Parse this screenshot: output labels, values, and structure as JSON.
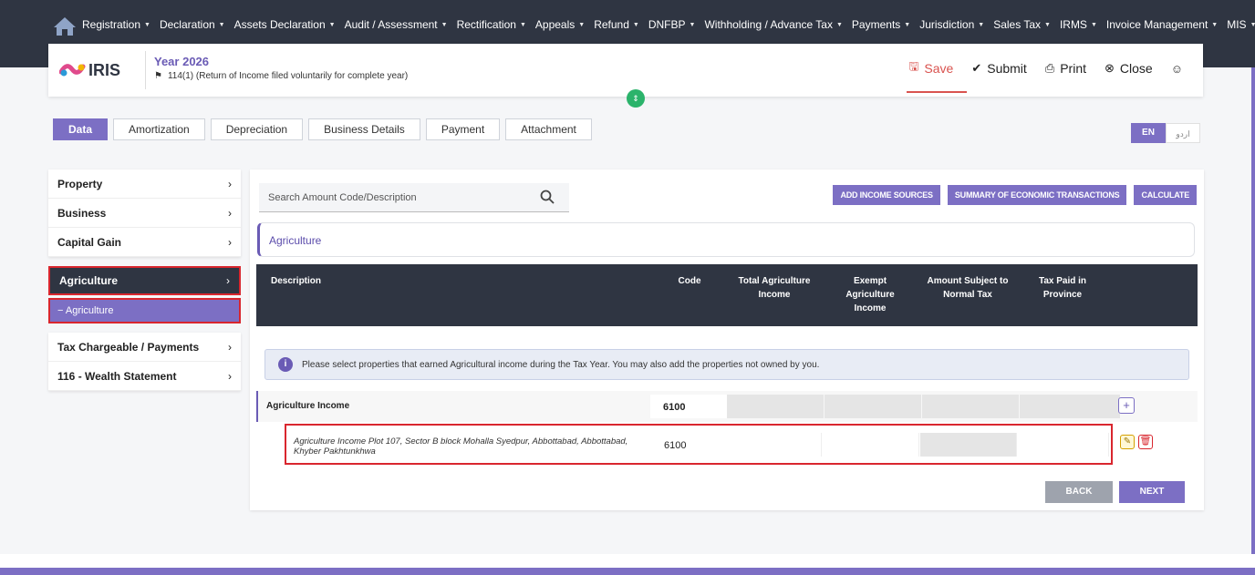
{
  "nav": [
    {
      "label": "Registration"
    },
    {
      "label": "Declaration"
    },
    {
      "label": "Assets Declaration"
    },
    {
      "label": "Audit / Assessment"
    },
    {
      "label": "Rectification"
    },
    {
      "label": "Appeals"
    },
    {
      "label": "Refund"
    },
    {
      "label": "DNFBP"
    },
    {
      "label": "Withholding / Advance Tax"
    },
    {
      "label": "Payments"
    },
    {
      "label": "Jurisdiction"
    },
    {
      "label": "Sales Tax"
    },
    {
      "label": "IRMS"
    },
    {
      "label": "Invoice Management"
    },
    {
      "label": "MIS"
    }
  ],
  "header": {
    "year": "Year 2026",
    "return_type": "114(1) (Return of Income filed voluntarily for complete year)",
    "save": "Save",
    "submit": "Submit",
    "print": "Print",
    "close": "Close"
  },
  "tabs": [
    "Data",
    "Amortization",
    "Depreciation",
    "Business Details",
    "Payment",
    "Attachment"
  ],
  "lang": {
    "en": "EN",
    "ur": "اردو"
  },
  "sidebar": {
    "group1": [
      "Property",
      "Business",
      "Capital Gain"
    ],
    "selected": "Agriculture",
    "sub": "− Agriculture",
    "group3": [
      "Tax Chargeable / Payments",
      "116 - Wealth Statement"
    ]
  },
  "search": {
    "placeholder": "Search Amount Code/Description"
  },
  "actions": {
    "add": "ADD INCOME SOURCES",
    "summary": "SUMMARY OF ECONOMIC TRANSACTIONS",
    "calculate": "CALCULATE"
  },
  "section_title": "Agriculture",
  "columns": {
    "description": "Description",
    "code": "Code",
    "total": "Total Agriculture Income",
    "exempt": "Exempt Agriculture Income",
    "subject": "Amount Subject to Normal Tax",
    "paid": "Tax Paid in Province"
  },
  "info": "Please select properties that earned Agricultural income during the Tax Year. You may also add the properties not owned by you.",
  "income_row": {
    "label": "Agriculture Income",
    "code": "6100"
  },
  "detail_row": {
    "desc": "Agriculture Income Plot 107, Sector B block Mohalla Syedpur, Abbottabad, Abbottabad, Khyber Pakhtunkhwa",
    "code": "6100"
  },
  "buttons": {
    "back": "BACK",
    "next": "NEXT"
  },
  "colors": {
    "accent": "#7c6fc4",
    "dark": "#2f3542",
    "highlight": "#d9262e"
  }
}
